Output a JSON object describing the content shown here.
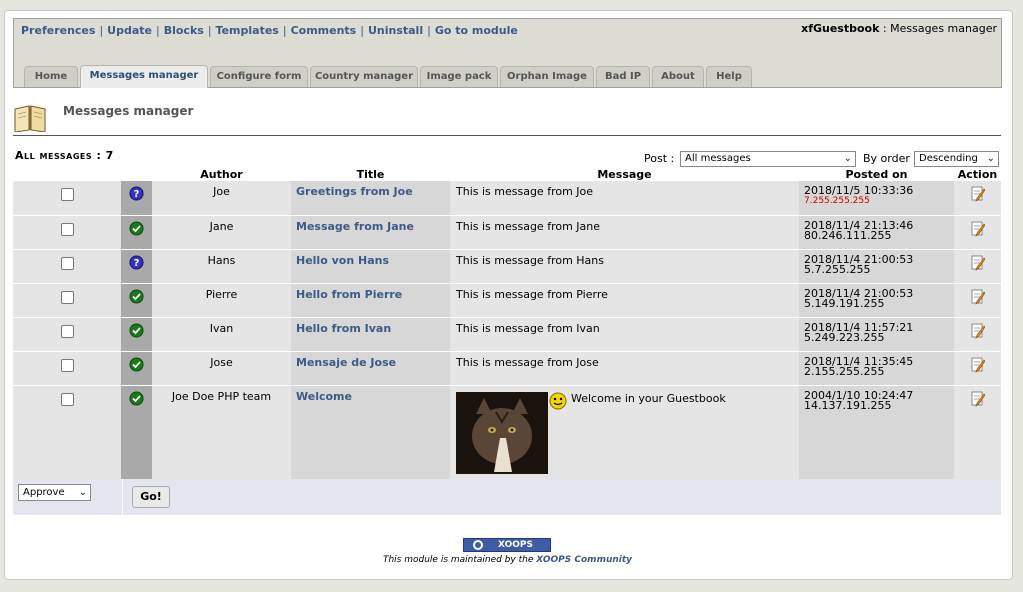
{
  "topmenu": {
    "links": [
      "Preferences",
      "Update",
      "Blocks",
      "Templates",
      "Comments",
      "Uninstall",
      "Go to module"
    ],
    "module_name": "xfGuestbook",
    "module_sep": " : ",
    "module_page": "Messages manager"
  },
  "tabs": [
    "Home",
    "Messages manager",
    "Configure form",
    "Country manager",
    "Image pack",
    "Orphan Image",
    "Bad IP",
    "About",
    "Help"
  ],
  "active_tab": "Messages manager",
  "page_title": "Messages manager",
  "filters": {
    "all_messages_label": "All messages : 7",
    "post_label": "Post :",
    "post_value": "All messages",
    "order_label": "By order",
    "order_value": "Descending"
  },
  "table": {
    "headers": [
      "",
      "",
      "Author",
      "Title",
      "Message",
      "Posted on",
      "Action"
    ],
    "rows": [
      {
        "status": "pending",
        "author": "Joe",
        "title": "Greetings from Joe",
        "message": "This is message from Joe",
        "date": "2018/11/5 10:33:36",
        "ip": "7.255.255.255",
        "ip_flag": true
      },
      {
        "status": "approved",
        "author": "Jane",
        "title": "Message from Jane",
        "message": "This is message from Jane",
        "date": "2018/11/4 21:13:46",
        "ip": "80.246.111.255",
        "ip_flag": false
      },
      {
        "status": "pending",
        "author": "Hans",
        "title": "Hello von Hans",
        "message": "This is message from Hans",
        "date": "2018/11/4 21:00:53",
        "ip": "5.7.255.255",
        "ip_flag": false
      },
      {
        "status": "approved",
        "author": "Pierre",
        "title": "Hello from Pierre",
        "message": "This is message from Pierre",
        "date": "2018/11/4 21:00:53",
        "ip": "5.149.191.255",
        "ip_flag": false
      },
      {
        "status": "approved",
        "author": "Ivan",
        "title": "Hello from Ivan",
        "message": "This is message from Ivan",
        "date": "2018/11/4 11:57:21",
        "ip": "5.249.223.255",
        "ip_flag": false
      },
      {
        "status": "approved",
        "author": "Jose",
        "title": "Mensaje de Jose",
        "message": "This is message from Jose",
        "date": "2018/11/4 11:35:45",
        "ip": "2.155.255.255",
        "ip_flag": false
      },
      {
        "status": "approved",
        "author": "Joe Doe PHP team",
        "title": "Welcome",
        "message": "Welcome in your Guestbook",
        "date": "2004/1/10 10:24:47",
        "ip": "14.137.191.255",
        "ip_flag": false,
        "has_image": true
      }
    ]
  },
  "bulk": {
    "action_value": "Approve",
    "go_label": "Go!"
  },
  "footer": {
    "badge": "XOOPS",
    "text_before": "This module is maintained by the ",
    "link": "XOOPS Community"
  },
  "colors": {
    "link": "#3d5a87",
    "ip_warning": "#cc0000",
    "approved": "#1a7a1a",
    "pending": "#3333cc"
  }
}
